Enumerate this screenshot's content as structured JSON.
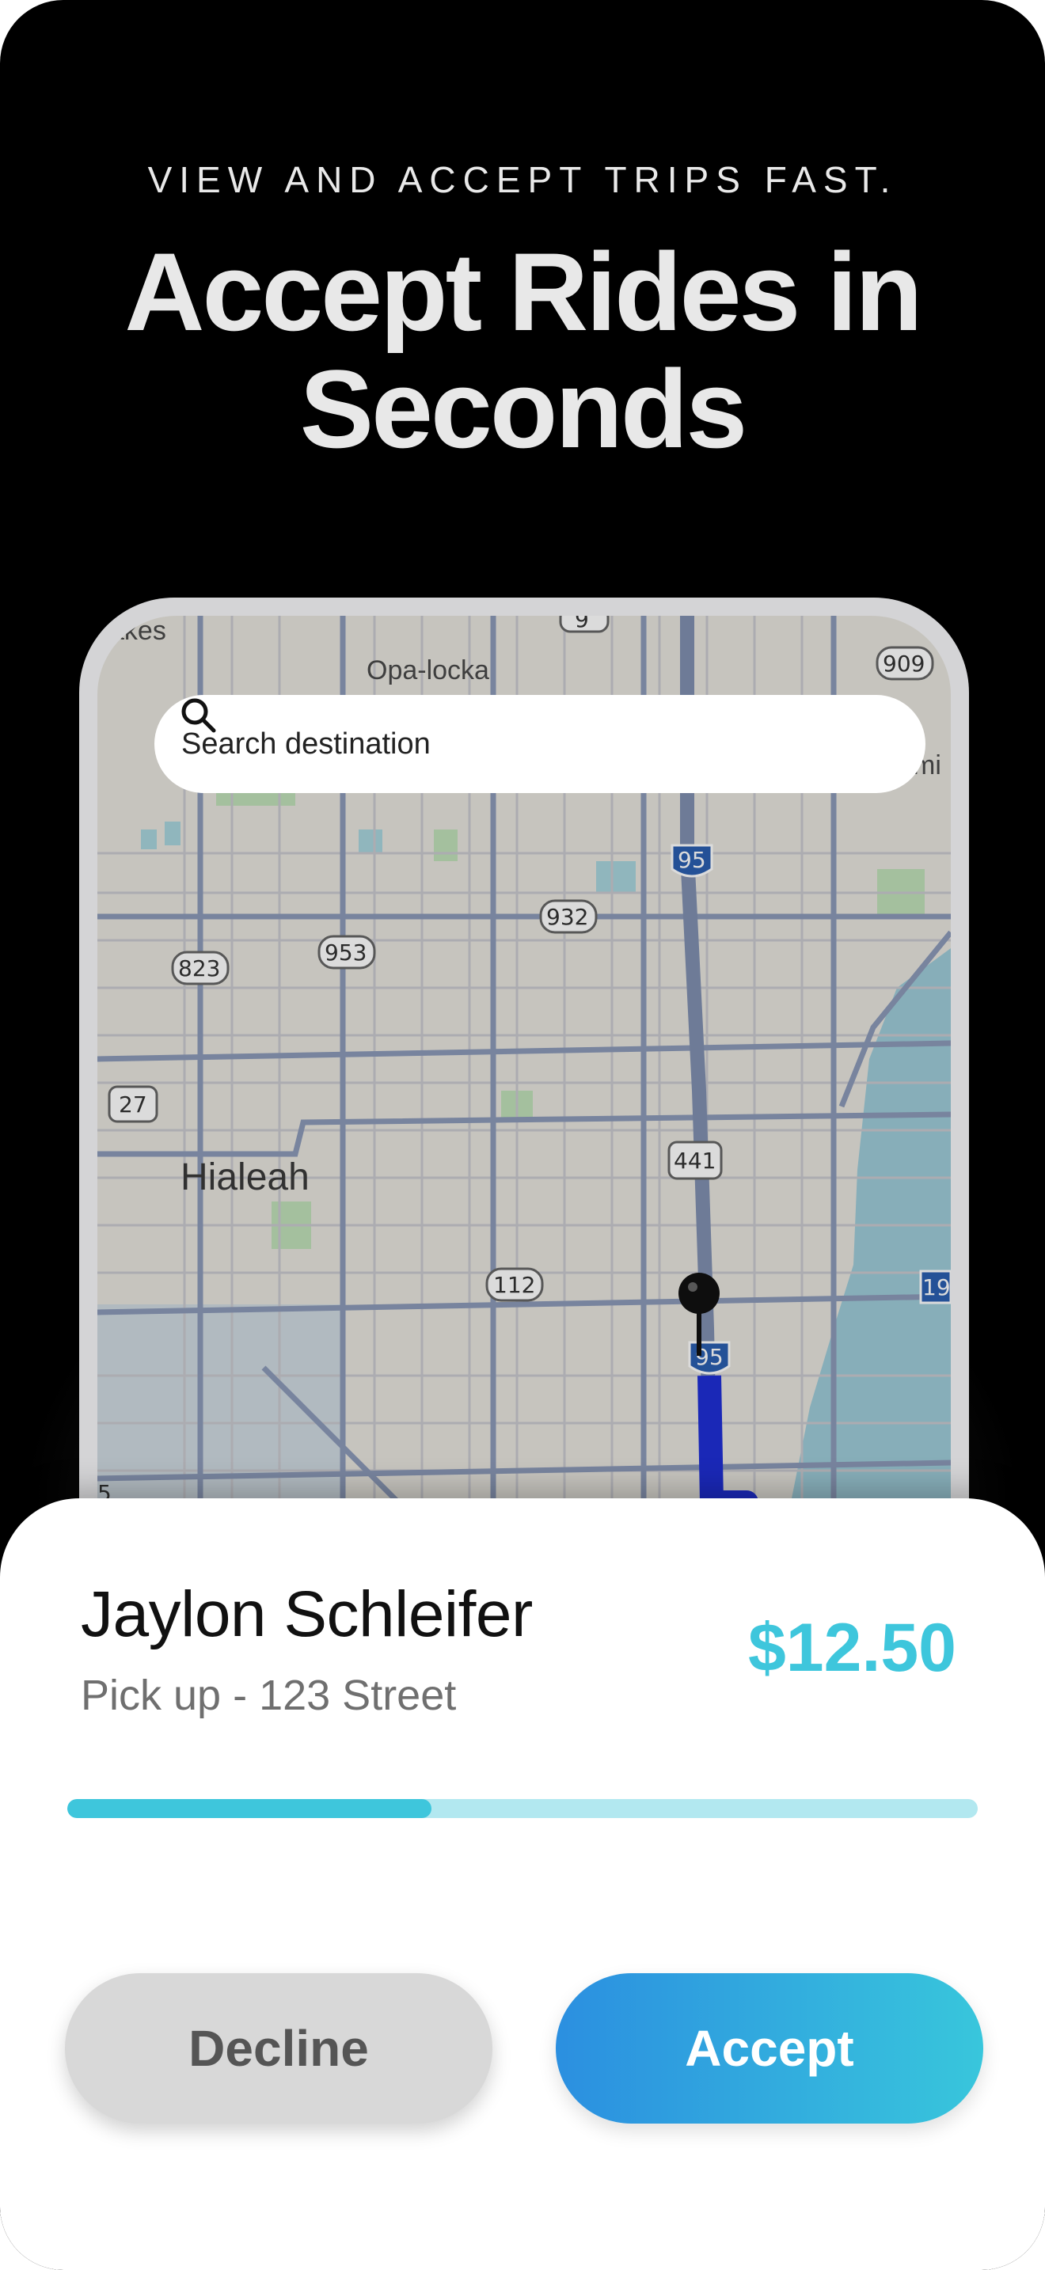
{
  "header": {
    "eyebrow": "VIEW AND ACCEPT TRIPS FAST.",
    "headline_line1": "Accept Rides in",
    "headline_line2": "Seconds"
  },
  "map": {
    "search_placeholder": "Search destination",
    "city_label": "Hialeah",
    "partial_labels": [
      "akes",
      "Opa-locka",
      "mi"
    ],
    "route_shields": [
      "9",
      "909",
      "95",
      "932",
      "953",
      "823",
      "27",
      "441",
      "112",
      "95",
      "19",
      "5"
    ]
  },
  "ride_request": {
    "rider_name": "Jaylon Schleifer",
    "pickup": "Pick up - 123 Street",
    "fare": "$12.50",
    "progress_fraction": 0.4
  },
  "actions": {
    "decline_label": "Decline",
    "accept_label": "Accept"
  },
  "colors": {
    "accent": "#3ec6dc",
    "accept_gradient_start": "#2b8fe0",
    "route_blue": "#1f2fd6"
  },
  "icons": {
    "search": "search-icon",
    "location_pin": "location-pin-icon"
  }
}
